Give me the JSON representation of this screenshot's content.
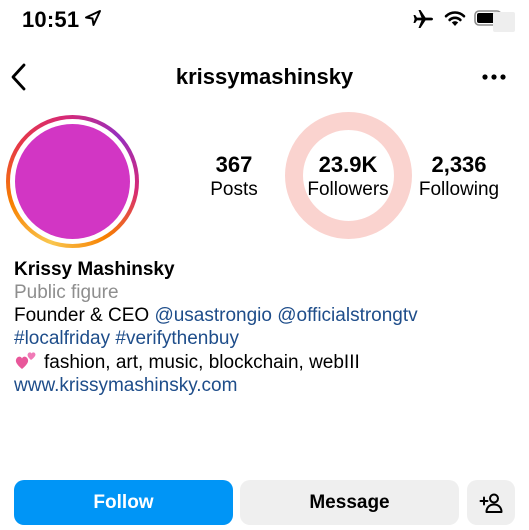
{
  "status_bar": {
    "time": "10:51",
    "icons": [
      "location-arrow-icon",
      "airplane-icon",
      "wifi-icon",
      "battery-icon"
    ]
  },
  "nav": {
    "username": "krissymashinsky",
    "icons": [
      "back-chevron-icon",
      "more-options-icon"
    ]
  },
  "profile": {
    "avatar_color": "#d236c4"
  },
  "stats": {
    "posts_count": "367",
    "posts_label": "Posts",
    "followers_count": "23.9K",
    "followers_label": "Followers",
    "following_count": "2,336",
    "following_label": "Following"
  },
  "bio": {
    "name": "Krissy Mashinsky",
    "category": "Public figure",
    "line1_prefix": "Founder & CEO ",
    "mention1": "@usastrongio",
    "mention2": "@officialstrongtv",
    "hashtag1": "#localfriday",
    "hashtag2": "#verifythenbuy",
    "emoji_icon": "two-hearts-icon",
    "interests": "fashion, art, music, blockchain, webIII",
    "website": "www.krissymashinsky.com"
  },
  "buttons": {
    "follow": "Follow",
    "message": "Message",
    "suggest_icon": "add-person-icon"
  },
  "colors": {
    "follow_button": "#0095f6",
    "secondary_button": "#efefef",
    "link": "#1e4d8a",
    "muted_text": "#8e8e8e",
    "highlight_ring": "#f2968c"
  }
}
